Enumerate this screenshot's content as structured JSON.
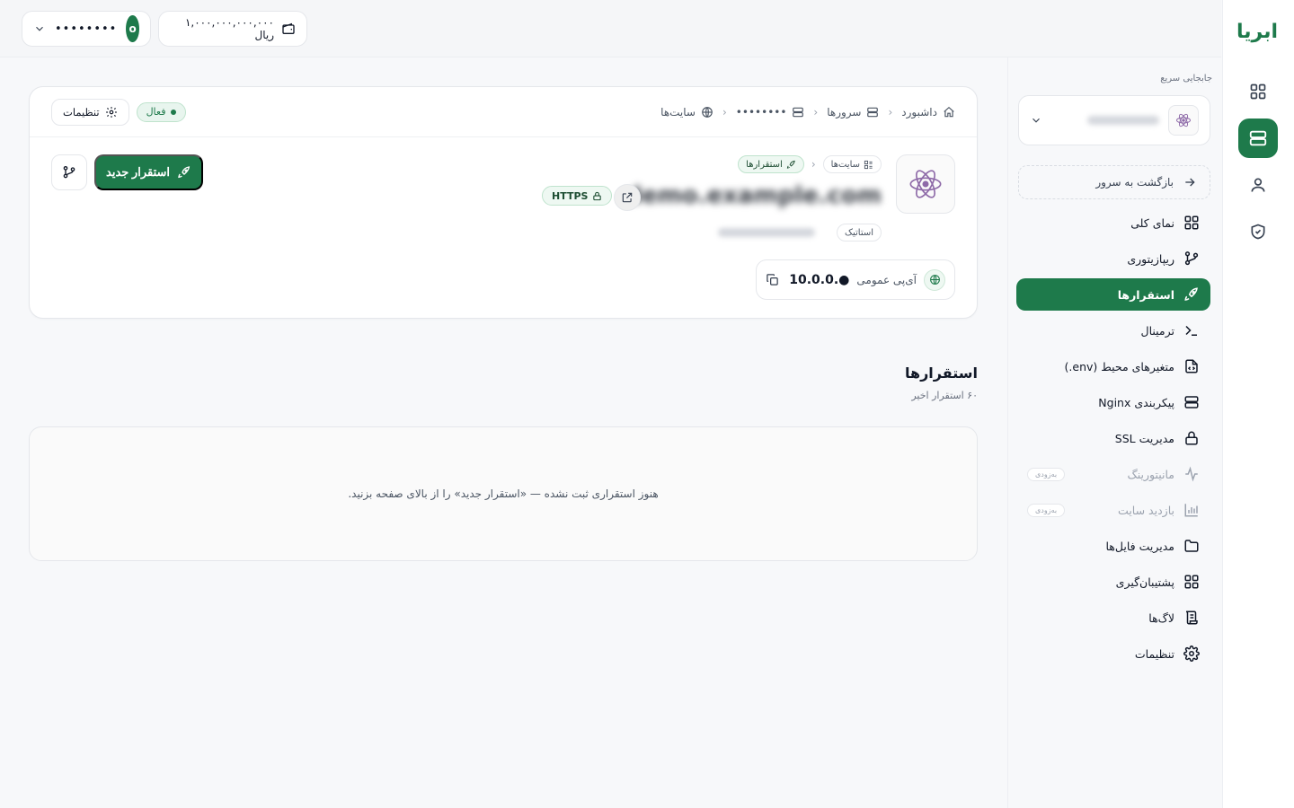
{
  "brand": {
    "logo_text": "ابریا"
  },
  "topbar": {
    "user_initial": "o",
    "user_name": "••••••••",
    "wallet_amount": "۱,۰۰۰,۰۰۰,۰۰۰,۰۰۰ ریال"
  },
  "sidebar": {
    "quick_switch_label": "جابجایی سریع",
    "back_label": "بازگشت به سرور",
    "soon_badge": "به‌زودی",
    "items": [
      {
        "label": "نمای کلی",
        "icon": "grid-icon"
      },
      {
        "label": "ریپازیتوری",
        "icon": "git-branch-icon"
      },
      {
        "label": "استقرارها",
        "icon": "rocket-icon",
        "active": true
      },
      {
        "label": "ترمینال",
        "icon": "terminal-icon"
      },
      {
        "label": "متغیرهای محیط (env.)",
        "icon": "file-code-icon"
      },
      {
        "label": "پیکربندی Nginx",
        "icon": "server-icon"
      },
      {
        "label": "مدیریت SSL",
        "icon": "lock-icon"
      },
      {
        "label": "مانیتورینگ",
        "icon": "activity-icon",
        "disabled": true
      },
      {
        "label": "بازدید سایت",
        "icon": "bar-chart-icon",
        "disabled": true
      },
      {
        "label": "مدیریت فایل‌ها",
        "icon": "folder-icon"
      },
      {
        "label": "پشتیبان‌گیری",
        "icon": "grid-icon"
      },
      {
        "label": "لاگ‌ها",
        "icon": "scroll-icon"
      },
      {
        "label": "تنظیمات",
        "icon": "gear-icon"
      }
    ]
  },
  "breadcrumb": {
    "dashboard": "داشبورد",
    "servers": "سرورها",
    "server_name": "••••••••",
    "sites": "سایت‌ها"
  },
  "header_actions": {
    "status": "فعال",
    "settings": "تنظیمات"
  },
  "site": {
    "crumb_sites": "سایت‌ها",
    "crumb_deploys": "استقرارها",
    "title": "demo.example.com",
    "https": "HTTPS",
    "type": "استاتیک",
    "domain": "demo.example.com",
    "ip_label": "آی‌پی عمومی",
    "ip_value": "10.0.0.●"
  },
  "actions": {
    "new_deploy": "استقرار جدید"
  },
  "deployments": {
    "title": "استقرارها",
    "subtitle": "۶۰ استقرار اخیر",
    "empty": "هنوز استقراری ثبت نشده — «استقرار جدید» را از بالای صفحه بزنید."
  },
  "colors": {
    "accent": "#1e7a4b"
  }
}
